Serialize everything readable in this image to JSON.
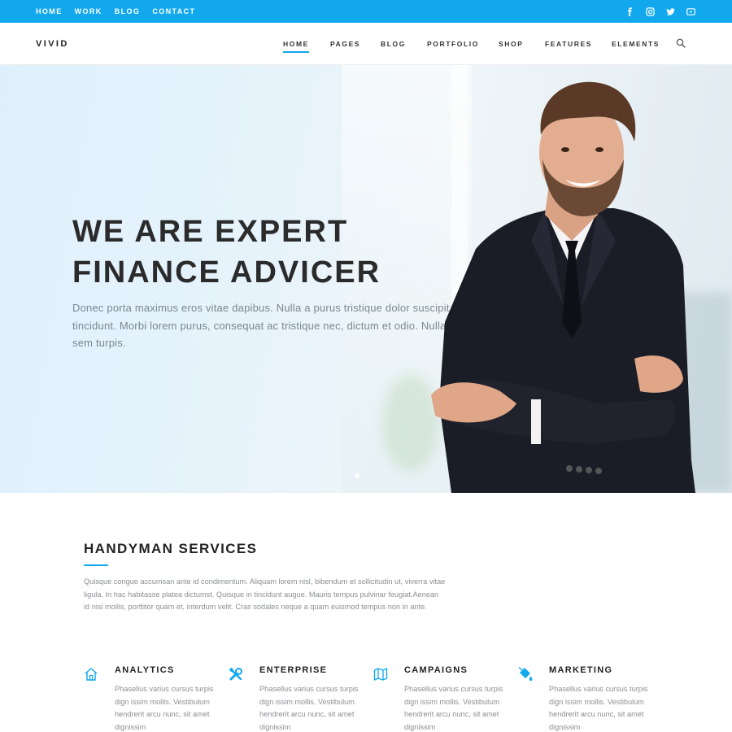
{
  "topbar": {
    "links": [
      "HOME",
      "WORK",
      "BLOG",
      "CONTACT"
    ],
    "social": [
      "facebook-icon",
      "instagram-icon",
      "twitter-icon",
      "youtube-icon"
    ],
    "color": "#11a8ee"
  },
  "header": {
    "logo": "VIVID",
    "nav": [
      "HOME",
      "PAGES",
      "BLOG",
      "PORTFOLIO",
      "SHOP",
      "FEATURES",
      "ELEMENTS"
    ],
    "active": "HOME",
    "search_icon": "search-icon"
  },
  "hero": {
    "title_line1": "WE ARE EXPERT",
    "title_line2": "FINANCE ADVICER",
    "description": "Donec porta maximus eros vitae dapibus. Nulla a purus tristique dolor suscipit tincidunt. Morbi lorem purus, consequat ac tristique nec, dictum et odio. Nulla eu sem turpis."
  },
  "services": {
    "title": "HANDYMAN SERVICES",
    "description": "Quisque congue accumsan ante id condimentum. Aliquam lorem nisl, bibendum et sollicitudin ut, viverra vitae ligula. In hac habitasse platea dictumst. Quisque in tincidunt augue. Mauris tempus pulvinar feugiat.Aenean id nisi mollis, porttitor quam et, interdum velit. Cras sodales neque a quam euismod tempus non in ante.",
    "items": [
      {
        "title": "ANALYTICS",
        "icon": "home-icon",
        "text": "Phasellus varius cursus turpis dign issim mollis. Vestibulum hendrerit arcu nunc, sit amet dignissim"
      },
      {
        "title": "ENTERPRISE",
        "icon": "tools-icon",
        "text": "Phasellus varius cursus turpis dign issim mollis. Vestibulum hendrerit arcu nunc, sit amet dignissim"
      },
      {
        "title": "CAMPAIGNS",
        "icon": "map-icon",
        "text": "Phasellus varius cursus turpis dign issim mollis. Vestibulum hendrerit arcu nunc, sit amet dignissim"
      },
      {
        "title": "MARKETING",
        "icon": "paint-bucket-icon",
        "text": "Phasellus varius cursus turpis dign issim mollis. Vestibulum hendrerit arcu nunc, sit amet dignissim"
      }
    ]
  }
}
